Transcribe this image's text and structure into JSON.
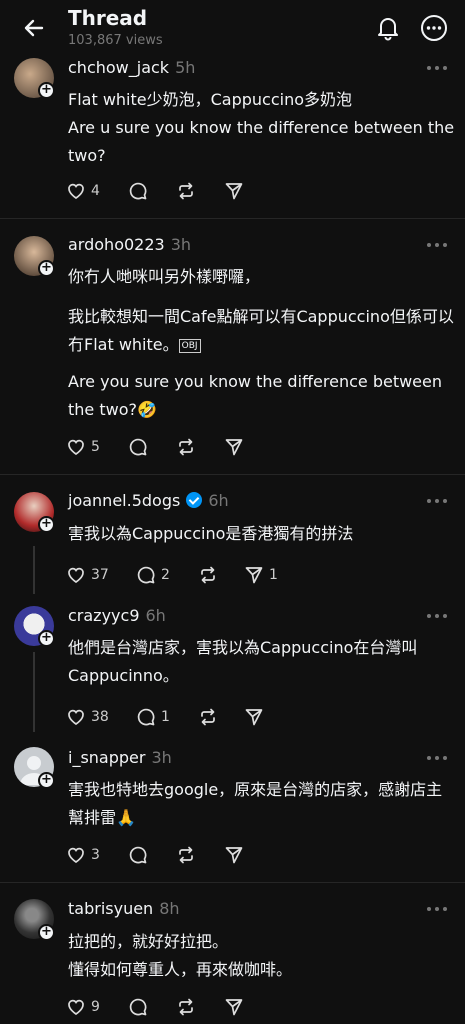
{
  "header": {
    "title": "Thread",
    "views": "103,867 views"
  },
  "posts": [
    {
      "username": "chchow_jack",
      "time": "5h",
      "text": "Flat white少奶泡，Cappuccino多奶泡\nAre u sure you know the difference between the two?",
      "likes": "4",
      "replies": "",
      "reposts": ""
    },
    {
      "username": "ardoho0223",
      "time": "3h",
      "text_p1": "你冇人哋咪叫另外樣嘢囉，",
      "text_p2": "我比較想知一間Cafe點解可以有Cappuccino但係可以冇Flat white。",
      "obj": "OBJ",
      "text_p3": "Are you sure you know the difference between the two?🤣",
      "likes": "5"
    },
    {
      "username": "joannel.5dogs",
      "time": "6h",
      "verified": true,
      "text": "害我以為Cappuccino是香港獨有的拼法",
      "likes": "37",
      "replies": "2",
      "shares": "1"
    },
    {
      "username": "crazyyc9",
      "time": "6h",
      "text": "他們是台灣店家，害我以為Cappuccino在台灣叫Cappucinno。",
      "likes": "38",
      "replies": "1"
    },
    {
      "username": "i_snapper",
      "time": "3h",
      "text": "害我也特地去google，原來是台灣的店家，感謝店主幫排雷🙏",
      "likes": "3"
    },
    {
      "username": "tabrisyuen",
      "time": "8h",
      "text": "拉把的，就好好拉把。\n懂得如何尊重人，再來做咖啡。",
      "likes": "9"
    }
  ],
  "icons": {
    "back": "arrow-left-icon",
    "bell": "bell-icon",
    "more": "more-circle-icon",
    "like": "heart-icon",
    "reply": "comment-icon",
    "repost": "repost-icon",
    "share": "send-icon"
  },
  "colors": {
    "background": "#101010",
    "text": "#f3f5f7",
    "muted": "#777777",
    "verified": "#0095f6"
  }
}
